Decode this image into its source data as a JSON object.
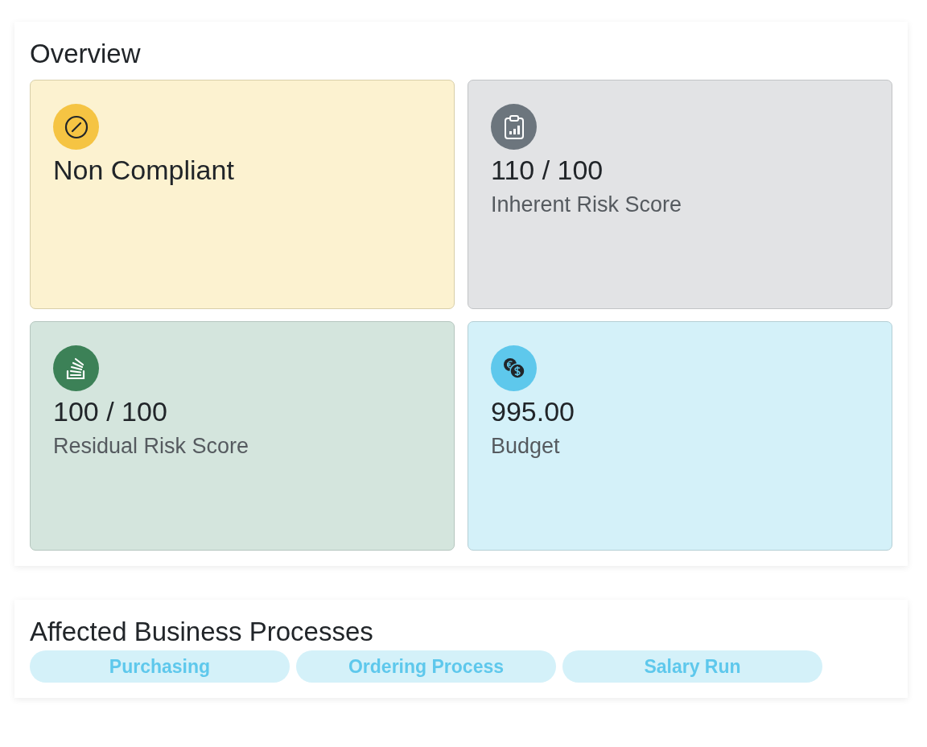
{
  "overview": {
    "title": "Overview",
    "cards": [
      {
        "kind": "compliance",
        "value": "Non Compliant"
      },
      {
        "kind": "inherent",
        "value": "110 / 100",
        "label": "Inherent Risk Score"
      },
      {
        "kind": "residual",
        "value": "100 / 100",
        "label": "Residual Risk Score"
      },
      {
        "kind": "budget",
        "value": "995.00",
        "label": "Budget"
      }
    ]
  },
  "processes": {
    "title": "Affected Business Processes",
    "items": [
      "Purchasing",
      "Ordering Process",
      "Salary Run"
    ]
  }
}
